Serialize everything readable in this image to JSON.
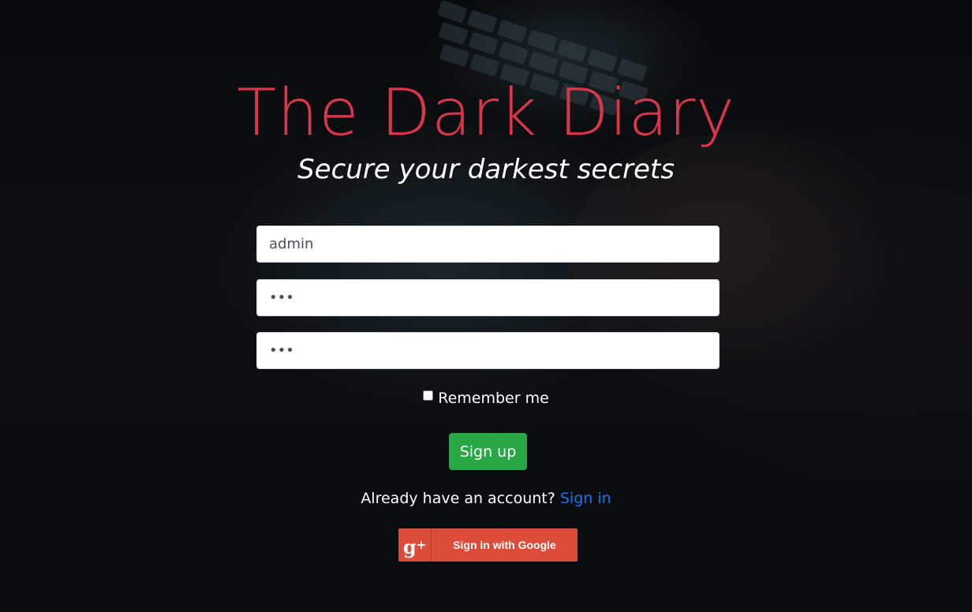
{
  "header": {
    "title": "The Dark Diary",
    "subtitle": "Secure your darkest secrets"
  },
  "form": {
    "username_value": "admin",
    "password_value": "abc",
    "confirm_password_value": "abc",
    "remember_label": "Remember me",
    "remember_checked": false,
    "submit_label": "Sign up"
  },
  "footer": {
    "already_text": "Already have an account?",
    "signin_link": "Sign in"
  },
  "google_button": {
    "icon": "google-plus-icon",
    "icon_text": "g+",
    "label": "Sign in with Google"
  },
  "colors": {
    "title": "#d9364b",
    "signup": "#28a745",
    "link": "#1a73e8",
    "google": "#dd4b39"
  }
}
